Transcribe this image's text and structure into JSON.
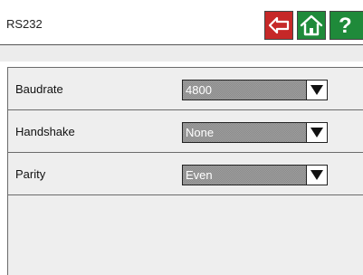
{
  "header": {
    "title": "RS232",
    "buttons": [
      {
        "icon": "back-arrow-icon",
        "color": "#c62828"
      },
      {
        "icon": "home-icon",
        "color": "#1f8a3a"
      },
      {
        "icon": "help-icon",
        "label": "?",
        "color": "#1f8a3a"
      }
    ]
  },
  "settings": [
    {
      "label": "Baudrate",
      "value": "4800",
      "icon": "dropdown-arrow-icon"
    },
    {
      "label": "Handshake",
      "value": "None",
      "icon": "dropdown-arrow-icon"
    },
    {
      "label": "Parity",
      "value": "Even",
      "icon": "dropdown-arrow-icon"
    }
  ]
}
